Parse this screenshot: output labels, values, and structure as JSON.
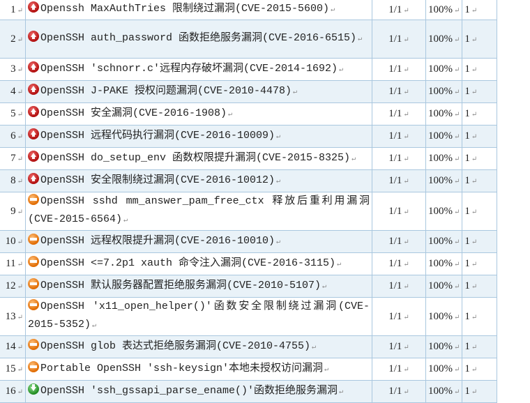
{
  "paragraph_mark": "↵",
  "vulnerabilities": [
    {
      "no": "1",
      "name": "Openssh MaxAuthTries 限制绕过漏洞(CVE-2015-5600)",
      "level": "high",
      "hits": "1/1",
      "pct": "100%",
      "count": "1"
    },
    {
      "no": "2",
      "name": "OpenSSH auth_password 函数拒绝服务漏洞(CVE-2016-6515)",
      "level": "high",
      "hits": "1/1",
      "pct": "100%",
      "count": "1"
    },
    {
      "no": "3",
      "name": "OpenSSH 'schnorr.c'远程内存破坏漏洞(CVE-2014-1692)",
      "level": "high",
      "hits": "1/1",
      "pct": "100%",
      "count": "1"
    },
    {
      "no": "4",
      "name": "OpenSSH J-PAKE 授权问题漏洞(CVE-2010-4478)",
      "level": "high",
      "hits": "1/1",
      "pct": "100%",
      "count": "1"
    },
    {
      "no": "5",
      "name": "OpenSSH 安全漏洞(CVE-2016-1908)",
      "level": "high",
      "hits": "1/1",
      "pct": "100%",
      "count": "1"
    },
    {
      "no": "6",
      "name": "OpenSSH 远程代码执行漏洞(CVE-2016-10009)",
      "level": "high",
      "hits": "1/1",
      "pct": "100%",
      "count": "1"
    },
    {
      "no": "7",
      "name": "OpenSSH do_setup_env 函数权限提升漏洞(CVE-2015-8325)",
      "level": "high",
      "hits": "1/1",
      "pct": "100%",
      "count": "1"
    },
    {
      "no": "8",
      "name": "OpenSSH 安全限制绕过漏洞(CVE-2016-10012)",
      "level": "high",
      "hits": "1/1",
      "pct": "100%",
      "count": "1"
    },
    {
      "no": "9",
      "name": "OpenSSH sshd mm_answer_pam_free_ctx 释放后重利用漏洞(CVE-2015-6564)",
      "level": "med",
      "hits": "1/1",
      "pct": "100%",
      "count": "1"
    },
    {
      "no": "10",
      "name": "OpenSSH 远程权限提升漏洞(CVE-2016-10010)",
      "level": "med",
      "hits": "1/1",
      "pct": "100%",
      "count": "1"
    },
    {
      "no": "11",
      "name": "OpenSSH <=7.2p1 xauth 命令注入漏洞(CVE-2016-3115)",
      "level": "med",
      "hits": "1/1",
      "pct": "100%",
      "count": "1"
    },
    {
      "no": "12",
      "name": "OpenSSH 默认服务器配置拒绝服务漏洞(CVE-2010-5107)",
      "level": "med",
      "hits": "1/1",
      "pct": "100%",
      "count": "1"
    },
    {
      "no": "13",
      "name": "OpenSSH 'x11_open_helper()'函数安全限制绕过漏洞(CVE-2015-5352)",
      "level": "med",
      "hits": "1/1",
      "pct": "100%",
      "count": "1"
    },
    {
      "no": "14",
      "name": "OpenSSH glob 表达式拒绝服务漏洞(CVE-2010-4755)",
      "level": "med",
      "hits": "1/1",
      "pct": "100%",
      "count": "1"
    },
    {
      "no": "15",
      "name": "Portable OpenSSH 'ssh-keysign'本地未授权访问漏洞",
      "level": "med",
      "hits": "1/1",
      "pct": "100%",
      "count": "1"
    },
    {
      "no": "16",
      "name": "OpenSSH 'ssh_gssapi_parse_ename()'函数拒绝服务漏洞",
      "level": "low",
      "hits": "1/1",
      "pct": "100%",
      "count": "1"
    }
  ]
}
